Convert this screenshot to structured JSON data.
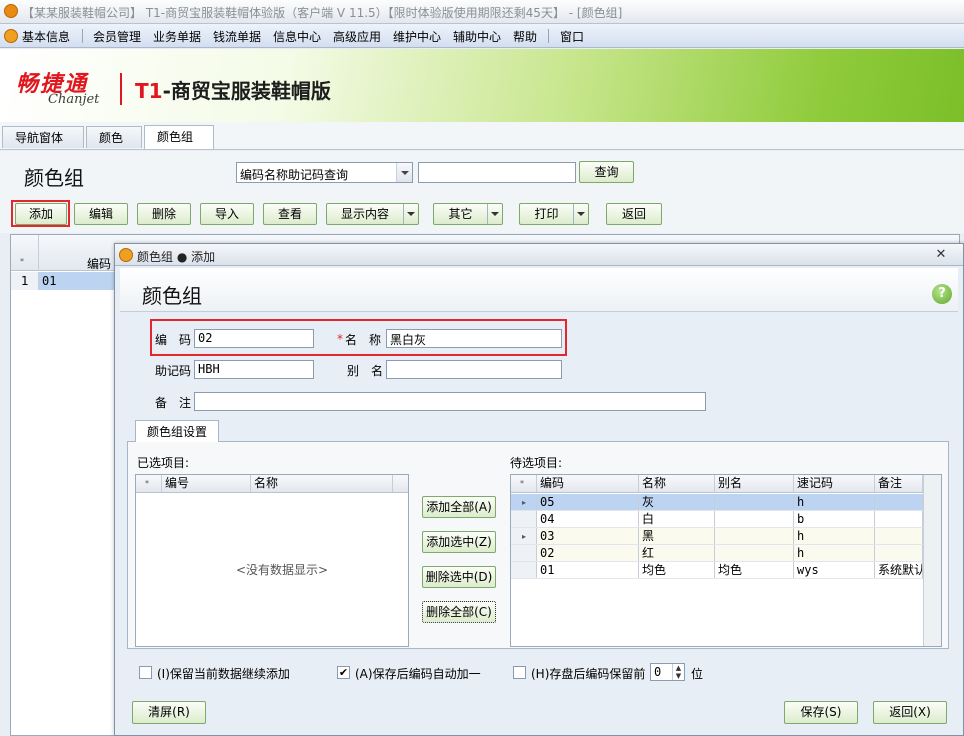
{
  "window": {
    "title": "【某某服装鞋帽公司】 T1-商贸宝服装鞋帽体验版（客户端 V 11.5）【限时体验版使用期限还剩45天】 - [颜色组]"
  },
  "menu": {
    "items": [
      "基本信息",
      "会员管理",
      "业务单据",
      "钱流单据",
      "信息中心",
      "高级应用",
      "维护中心",
      "辅助中心",
      "帮助",
      "窗口"
    ]
  },
  "banner": {
    "logo_cn": "畅捷通",
    "logo_en": "Chanjet",
    "product_red": "T1",
    "product_rest": "-商贸宝服装鞋帽版"
  },
  "tabs": [
    "导航窗体",
    "颜色",
    "颜色组"
  ],
  "page": {
    "title": "颜色组",
    "search_mode": "编码名称助记码查询",
    "search_value": "",
    "query_label": "查询"
  },
  "toolbar": {
    "add": "添加",
    "edit": "编辑",
    "delete": "删除",
    "import": "导入",
    "view": "查看",
    "display": "显示内容",
    "other": "其它",
    "print": "打印",
    "back": "返回"
  },
  "list": {
    "col_code": "编码",
    "row_num": "1",
    "row_code": "01",
    "row_marker": "*"
  },
  "dialog": {
    "title": "颜色组 ● 添加",
    "header": "颜色组",
    "help": "?",
    "close": "✕",
    "fields": {
      "code_label": "编　码",
      "code_value": "02",
      "name_req": "*",
      "name_label": "名　称",
      "name_value": "黑白灰",
      "mnemonic_label": "助记码",
      "mnemonic_value": "HBH",
      "alias_label": "别　名",
      "alias_value": "",
      "remark_label": "备　注",
      "remark_value": ""
    },
    "group_tab": "颜色组设置",
    "selected": {
      "title": "已选项目:",
      "columns": [
        "*",
        "编号",
        "名称"
      ],
      "empty": "<没有数据显示>"
    },
    "actions": {
      "add_all": "添加全部(A)",
      "add_selected": "添加选中(Z)",
      "remove_selected": "删除选中(D)",
      "remove_all": "删除全部(C)"
    },
    "available": {
      "title": "待选项目:",
      "columns": [
        "*",
        "编码",
        "名称",
        "别名",
        "速记码",
        "备注"
      ],
      "rows": [
        {
          "marker": "▸",
          "code": "05",
          "name": "灰",
          "alias": "",
          "shorthand": "h",
          "note": ""
        },
        {
          "marker": "",
          "code": "04",
          "name": "白",
          "alias": "",
          "shorthand": "b",
          "note": ""
        },
        {
          "marker": "▸",
          "code": "03",
          "name": "黑",
          "alias": "",
          "shorthand": "h",
          "note": ""
        },
        {
          "marker": "",
          "code": "02",
          "name": "红",
          "alias": "",
          "shorthand": "h",
          "note": ""
        },
        {
          "marker": "",
          "code": "01",
          "name": "均色",
          "alias": "均色",
          "shorthand": "wys",
          "note": "系统默认"
        }
      ]
    },
    "options": {
      "keep_data": "(I)保留当前数据继续添加",
      "keep_data_checked": false,
      "auto_increment": "(A)保存后编码自动加一",
      "auto_increment_checked": true,
      "keep_digits": "(H)存盘后编码保留前",
      "keep_digits_value": "0",
      "digits_unit": "位"
    },
    "buttons": {
      "clear": "清屏(R)",
      "save": "保存(S)",
      "back": "返回(X)"
    }
  }
}
